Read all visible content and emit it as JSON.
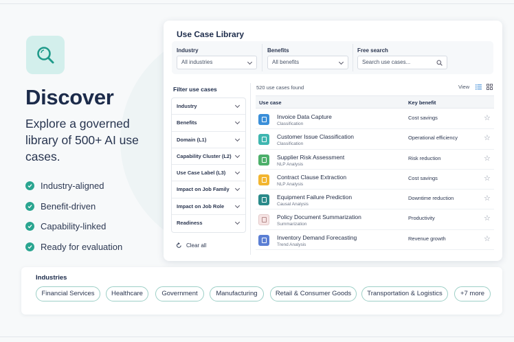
{
  "hero": {
    "title": "Discover",
    "subtitle": "Explore a governed library of 500+ AI use cases.",
    "icon": "search-icon",
    "accent": "#2aa590",
    "benefits": [
      "Industry-aligned",
      "Benefit-driven",
      "Capability-linked",
      "Ready for evaluation"
    ]
  },
  "library": {
    "title": "Use Case Library",
    "filters_bar": {
      "industry_label": "Industry",
      "industry_value": "All industries",
      "benefits_label": "Benefits",
      "benefits_value": "All benefits",
      "search_label": "Free search",
      "search_placeholder": "Search use cases..."
    },
    "filter_panel": {
      "title": "Filter use cases",
      "items": [
        "Industry",
        "Benefits",
        "Domain (L1)",
        "Capability Cluster (L2)",
        "Use Case Label (L3)",
        "Impact on Job Family",
        "Impact on Job Role",
        "Readiness"
      ],
      "clear_label": "Clear all"
    },
    "results_count": "520 use cases found",
    "view_label": "View",
    "columns": [
      "Use case",
      "Key benefit"
    ],
    "rows": [
      {
        "name": "Invoice Data Capture",
        "category": "Classification",
        "benefit": "Cost savings",
        "color": "#3b8fd9"
      },
      {
        "name": "Customer Issue Classification",
        "category": "Classification",
        "benefit": "Operational efficiency",
        "color": "#3fb6b0"
      },
      {
        "name": "Supplier Risk Assessment",
        "category": "NLP Analysis",
        "benefit": "Risk reduction",
        "color": "#4caf6a"
      },
      {
        "name": "Contract Clause Extraction",
        "category": "NLP Analysis",
        "benefit": "Cost savings",
        "color": "#f2b530"
      },
      {
        "name": "Equipment Failure Prediction",
        "category": "Causal Analysis",
        "benefit": "Downtime reduction",
        "color": "#2a8a8a"
      },
      {
        "name": "Policy Document Summarization",
        "category": "Summarization",
        "benefit": "Productivity",
        "color": "#f6e4e4"
      },
      {
        "name": "Inventory Demand Forecasting",
        "category": "Trend Analysis",
        "benefit": "Revenue growth",
        "color": "#5b7fd4"
      }
    ]
  },
  "industries": {
    "title": "Industries",
    "chips": [
      "Financial Services",
      "Healthcare",
      "Government",
      "Manufacturing",
      "Retail & Consumer Goods",
      "Transportation & Logistics",
      "+7 more"
    ]
  }
}
